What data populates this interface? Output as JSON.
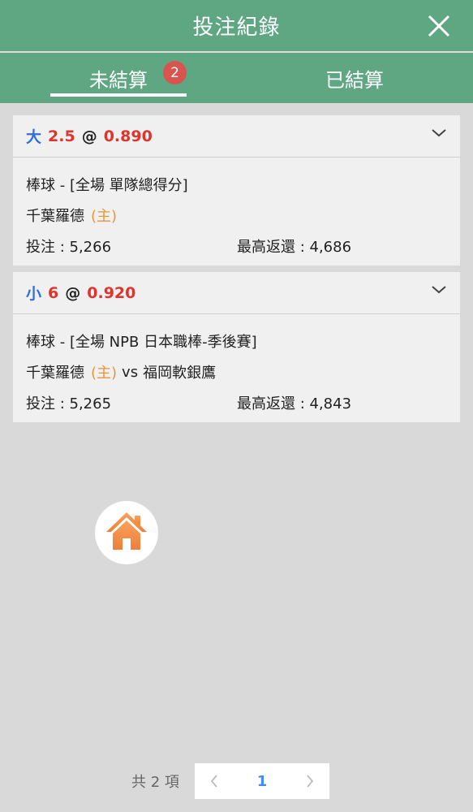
{
  "header": {
    "title": "投注紀錄",
    "close_icon": "close-icon"
  },
  "tabs": [
    {
      "label": "未結算",
      "badge": "2",
      "active": true
    },
    {
      "label": "已結算",
      "active": false
    }
  ],
  "bets": [
    {
      "selection": "大",
      "line": "2.5",
      "at": "@",
      "odds": "0.890",
      "market": "棒球 - [全場 單隊總得分]",
      "home_team": "千葉羅德",
      "home_tag": "(主)",
      "vs": "",
      "away_team": "",
      "stake_label": "投注 : 5,266",
      "max_return_label": "最高返還 : 4,686"
    },
    {
      "selection": "小",
      "line": "6",
      "at": "@",
      "odds": "0.920",
      "market": "棒球 - [全場 NPB 日本職棒-季後賽]",
      "home_team": "千葉羅德",
      "home_tag": "(主)",
      "vs": "vs",
      "away_team": "福岡軟銀鷹",
      "stake_label": "投注 : 5,265",
      "max_return_label": "最高返還 : 4,843"
    }
  ],
  "pagination": {
    "total_label": "共 2 項",
    "current_page": "1"
  },
  "colors": {
    "header": "#5fa683",
    "selection": "#2f6fd8",
    "odds": "#e0332c",
    "home_tag": "#e8953a",
    "badge": "#d9534f",
    "page_active": "#3d8ff5",
    "home_icon": "#f28a45"
  },
  "icons": [
    "close-icon",
    "chevron-down-icon",
    "home-icon",
    "chevron-left-icon",
    "chevron-right-icon"
  ]
}
